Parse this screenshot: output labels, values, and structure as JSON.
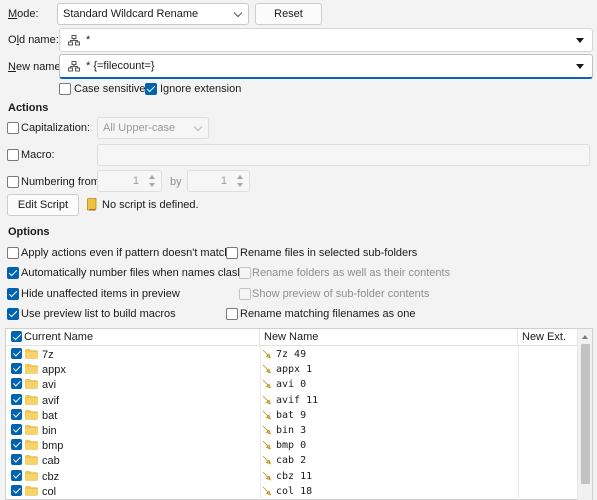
{
  "mode": {
    "label": "Mode:",
    "value": "Standard Wildcard Rename",
    "reset_label": "Reset"
  },
  "old_name": {
    "label": "Old name:",
    "value": "*"
  },
  "new_name": {
    "label": "New name:",
    "value": "* {=filecount=}"
  },
  "flags": {
    "case_sensitive": {
      "label": "Case sensitive",
      "checked": false
    },
    "ignore_extension": {
      "label": "Ignore extension",
      "checked": true
    }
  },
  "actions": {
    "heading": "Actions",
    "capitalization": {
      "label": "Capitalization:",
      "value": "All Upper-case",
      "checked": false
    },
    "macro": {
      "label": "Macro:",
      "checked": false
    },
    "numbering": {
      "label": "Numbering from:",
      "from": "1",
      "by_label": "by",
      "by": "1",
      "checked": false
    },
    "edit_script_label": "Edit Script",
    "script_status": "No script is defined."
  },
  "options": {
    "heading": "Options",
    "left": [
      {
        "label": "Apply actions even if pattern doesn't match",
        "checked": false
      },
      {
        "label": "Automatically number files when names clash",
        "checked": true
      },
      {
        "label": "Hide unaffected items in preview",
        "checked": true
      },
      {
        "label": "Use preview list to build macros",
        "checked": true
      }
    ],
    "right": [
      {
        "label": "Rename files in selected sub-folders",
        "checked": false,
        "enabled": true
      },
      {
        "label": "Rename folders as well as their contents",
        "checked": false,
        "enabled": false
      },
      {
        "label": "Show preview of sub-folder contents",
        "checked": false,
        "enabled": false
      },
      {
        "label": "Rename matching filenames as one",
        "checked": false,
        "enabled": true
      }
    ]
  },
  "preview": {
    "columns": [
      "Current Name",
      "New Name",
      "New Ext."
    ],
    "rows": [
      {
        "current": "7z",
        "new": "7z 49"
      },
      {
        "current": "appx",
        "new": "appx 1"
      },
      {
        "current": "avi",
        "new": "avi 0"
      },
      {
        "current": "avif",
        "new": "avif 11"
      },
      {
        "current": "bat",
        "new": "bat 9"
      },
      {
        "current": "bin",
        "new": "bin 3"
      },
      {
        "current": "bmp",
        "new": "bmp 0"
      },
      {
        "current": "cab",
        "new": "cab 2"
      },
      {
        "current": "cbz",
        "new": "cbz 11"
      },
      {
        "current": "col",
        "new": "col 18"
      }
    ]
  },
  "colors": {
    "accent": "#0063b1",
    "folder": "#f2c94c",
    "focus_underline": "#0a64b8"
  }
}
